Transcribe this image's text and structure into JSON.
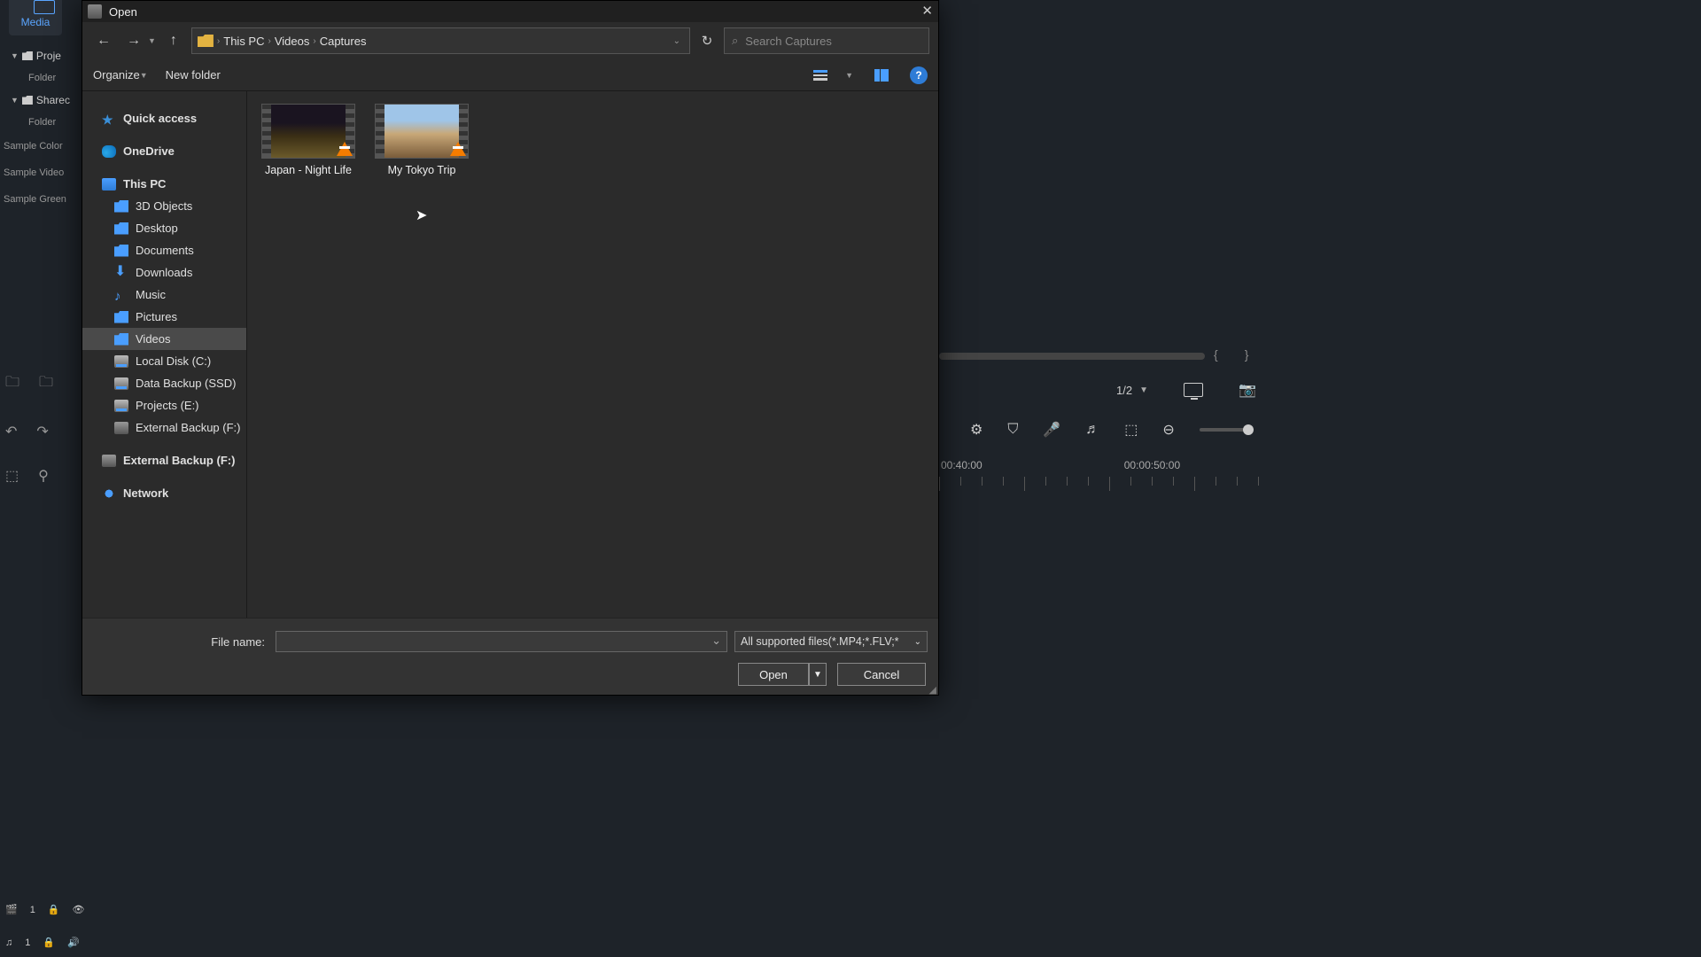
{
  "bg": {
    "media_tab": "Media",
    "tree": {
      "project": "Proje",
      "folder": "Folder",
      "shared": "Sharec"
    },
    "samples": [
      "Sample Color",
      "Sample Video",
      "Sample Green"
    ],
    "tracks": {
      "video": "1",
      "audio": "1"
    },
    "page": "1/2",
    "times": [
      "00:40:00",
      "00:00:50:00"
    ]
  },
  "dialog": {
    "title": "Open",
    "crumbs": [
      "This PC",
      "Videos",
      "Captures"
    ],
    "search_placeholder": "Search Captures",
    "toolbar": {
      "organize": "Organize",
      "newfolder": "New folder"
    },
    "sidebar": {
      "quick": "Quick access",
      "onedrive": "OneDrive",
      "thispc": "This PC",
      "items": [
        "3D Objects",
        "Desktop",
        "Documents",
        "Downloads",
        "Music",
        "Pictures",
        "Videos",
        "Local Disk (C:)",
        "Data Backup (SSD)",
        "Projects (E:)",
        "External Backup (F:)"
      ],
      "external2": "External Backup (F:)",
      "network": "Network"
    },
    "files": [
      {
        "name": "Japan - Night Life"
      },
      {
        "name": "My Tokyo Trip"
      }
    ],
    "footer": {
      "filename_label": "File name:",
      "filter": "All supported files(*.MP4;*.FLV;*",
      "open": "Open",
      "cancel": "Cancel"
    }
  }
}
